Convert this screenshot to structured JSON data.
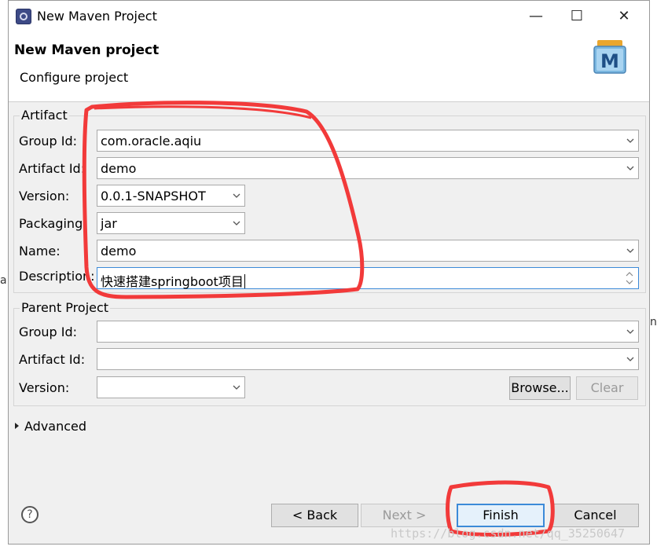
{
  "window": {
    "title": "New Maven Project",
    "controls": {
      "minimize": "—",
      "maximize": "☐",
      "close": "✕"
    }
  },
  "header": {
    "title": "New Maven project",
    "subtitle": "Configure project",
    "logo_icon": "maven-m-icon",
    "logo_letter": "M"
  },
  "artifact": {
    "group_label": "Artifact",
    "group_id": {
      "label": "Group Id:",
      "value": "com.oracle.aqiu"
    },
    "artifact_id": {
      "label": "Artifact Id:",
      "value": "demo"
    },
    "version": {
      "label": "Version:",
      "value": "0.0.1-SNAPSHOT"
    },
    "packaging": {
      "label": "Packaging:",
      "value": "jar"
    },
    "name": {
      "label": "Name:",
      "value": "demo"
    },
    "description": {
      "label": "Description:",
      "value": "快速搭建springboot项目"
    }
  },
  "parent": {
    "group_label": "Parent Project",
    "group_id": {
      "label": "Group Id:",
      "value": ""
    },
    "artifact_id": {
      "label": "Artifact Id:",
      "value": ""
    },
    "version": {
      "label": "Version:",
      "value": ""
    },
    "browse_label": "Browse...",
    "clear_label": "Clear"
  },
  "advanced": {
    "label": "Advanced"
  },
  "footer": {
    "help_label": "?",
    "back_label": "< Back",
    "next_label": "Next >",
    "finish_label": "Finish",
    "cancel_label": "Cancel"
  },
  "background_fragments": {
    "left_char": "a",
    "right_char": "n"
  },
  "watermark": "https://blog.csdn.net/qq_35250647",
  "colors": {
    "annotation_red": "#f23a3a",
    "focus_blue": "#3c8ad8",
    "dialog_bg": "#f0f0f0"
  }
}
